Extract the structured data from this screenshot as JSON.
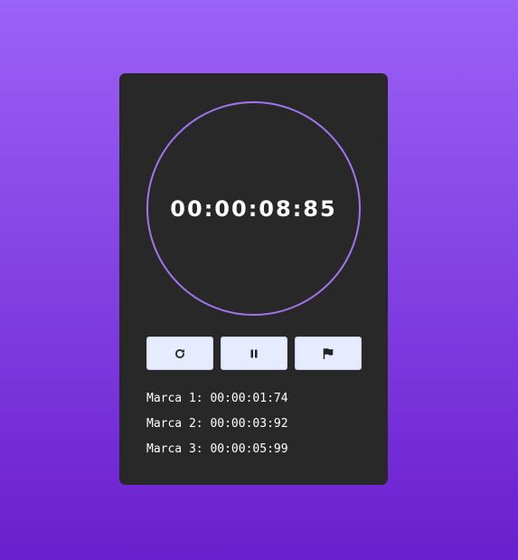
{
  "stopwatch": {
    "time": "00:00:08:85"
  },
  "controls": {
    "reset": {
      "icon": "restart-icon"
    },
    "pause": {
      "icon": "pause-icon"
    },
    "lap": {
      "icon": "flag-icon"
    }
  },
  "laps": [
    {
      "label": "Marca 1:",
      "time": "00:00:01:74"
    },
    {
      "label": "Marca 2:",
      "time": "00:00:03:92"
    },
    {
      "label": "Marca 3:",
      "time": "00:00:05:99"
    }
  ],
  "colors": {
    "background_top": "#9b62f7",
    "background_bottom": "#6a1fce",
    "card": "#282828",
    "ring": "#a374f0",
    "button": "#e6ebff"
  }
}
